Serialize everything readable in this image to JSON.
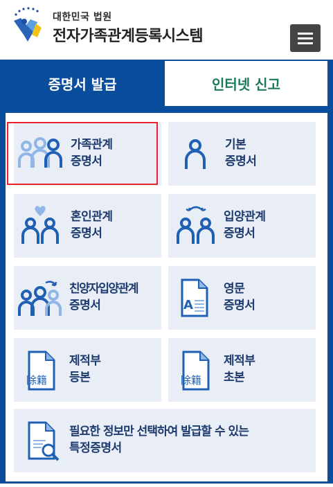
{
  "header": {
    "court_name": "대한민국 법원",
    "system_name": "전자가족관계등록시스템",
    "menu_icon": "hamburger-menu-icon"
  },
  "tabs": [
    {
      "label": "증명서 발급",
      "active": true
    },
    {
      "label": "인터넷 신고",
      "active": false
    }
  ],
  "certificates": [
    {
      "line1": "가족관계",
      "line2": "증명서",
      "icon": "family-icon",
      "selected": true
    },
    {
      "line1": "기본",
      "line2": "증명서",
      "icon": "person-icon"
    },
    {
      "line1": "혼인관계",
      "line2": "증명서",
      "icon": "couple-heart-icon"
    },
    {
      "line1": "입양관계",
      "line2": "증명서",
      "icon": "adoption-icon"
    },
    {
      "line1": "친양자입양관계",
      "line2": "증명서",
      "icon": "family-arrow-icon"
    },
    {
      "line1": "영문",
      "line2": "증명서",
      "icon": "english-document-icon"
    },
    {
      "line1": "제적부",
      "line2": "등본",
      "icon": "register-document-icon",
      "doc_text": "除籍"
    },
    {
      "line1": "제적부",
      "line2": "초본",
      "icon": "register-document-icon",
      "doc_text": "除籍"
    },
    {
      "line1": "필요한 정보만 선택하여 발급할 수 있는",
      "line2": "특정증명서",
      "icon": "search-document-icon"
    }
  ],
  "colors": {
    "brand_blue": "#0a4d9c",
    "tab_inactive_text": "#1a7a56",
    "card_bg": "#e9eef6",
    "icon_blue": "#1f5fb4",
    "icon_light": "#8fb6e6",
    "highlight_red": "#e8202a"
  }
}
